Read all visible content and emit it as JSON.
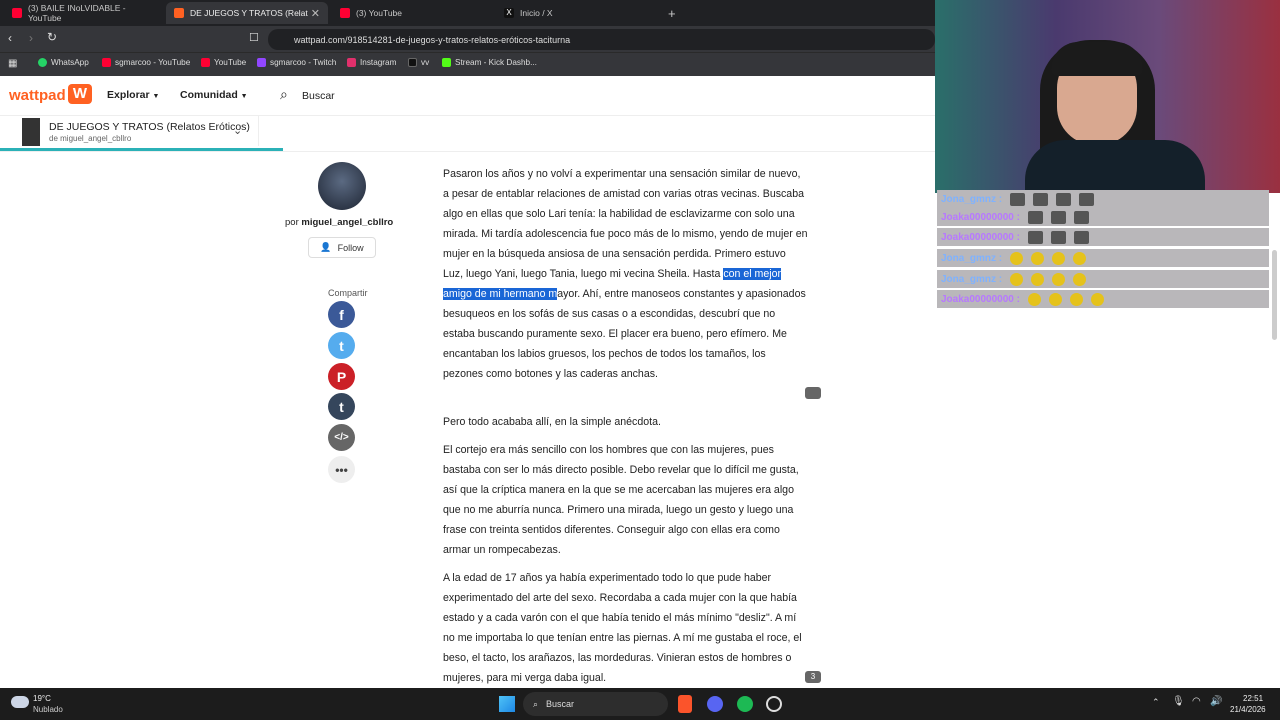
{
  "tabs": [
    {
      "label": "(3) BAILE INoLVIDABLE - YouTube",
      "color": "#ff0033"
    },
    {
      "label": "DE JUEGOS Y TRATOS (Relatos Er...",
      "color": "#ff6122"
    },
    {
      "label": "(3) YouTube",
      "color": "#ff0033"
    },
    {
      "label": "Inicio / X",
      "color": "#444444"
    }
  ],
  "url": "wattpad.com/918514281-de-juegos-y-tratos-relatos-eróticos-taciturna",
  "bookmarks": [
    "WhatsApp",
    "sgmarcoo - YouTube",
    "YouTube",
    "sgmarcoo - Twitch",
    "Instagram",
    "vv",
    "Stream - Kick Dashb..."
  ],
  "header": {
    "logo": "wattpad",
    "explore": "Explorar",
    "community": "Comunidad",
    "search": "Buscar"
  },
  "story": {
    "title": "DE JUEGOS Y TRATOS (Relatos Eróticos)",
    "author_line": "de miguel_angel_cbllro"
  },
  "author": {
    "prefix": "por ",
    "name": "miguel_angel_cbllro",
    "follow": "Follow"
  },
  "share": {
    "label": "Compartir"
  },
  "paragraphs": {
    "p1_before": "Pasaron los años y no volví a experimentar una sensación similar de nuevo, a pesar de entablar relaciones de amistad con varias otras vecinas. Buscaba algo en ellas que solo Lari tenía: la habilidad de esclavizarme con solo una mirada. Mi tardía adolescencia fue poco más de lo mismo, yendo de mujer en mujer en la búsqueda ansiosa de una sensación perdida. Primero estuvo Luz, luego Yani, luego Tania, luego mi vecina Sheila. Hasta ",
    "p1_highlight": "con el mejor amigo de mi hermano m",
    "p1_after": "ayor. Ahí, entre manoseos constantes y apasionados besuqueos en los sofás de sus casas o a escondidas, descubrí que no estaba buscando puramente sexo. El placer era bueno, pero efímero. Me encantaban los labios gruesos, los pechos de todos los tamaños, los pezones como botones y las caderas anchas.",
    "p2": "Pero todo acababa allí, en la simple anécdota.",
    "p3": "El cortejo era más sencillo con los hombres que con las mujeres, pues bastaba con ser lo más directo posible. Debo revelar que lo difícil me gusta, así que la críptica manera en la que se me acercaban las mujeres era algo que no me aburría nunca. Primero una mirada, luego un gesto y luego una frase con treinta sentidos diferentes. Conseguir algo con ellas era como armar un rompecabezas.",
    "p4": "A la edad de 17 años ya había experimentado todo lo que pude haber experimentado del arte del sexo. Recordaba a cada mujer con la que había estado y a cada varón con el que había tenido el más mínimo \"desliz\". A mí no me importaba lo que tenían entre las piernas. A mí me gustaba el roce, el beso, el tacto, los arañazos, las mordeduras. Vinieran estos de hombres o mujeres, para mi verga daba igual."
  },
  "comment_count": "3",
  "chat": [
    {
      "user": "Jona_gmnz :",
      "kind": "u1"
    },
    {
      "user": "Joaka00000000 :",
      "kind": "u2"
    },
    {
      "user": "Joaka00000000 :",
      "kind": "u2"
    },
    {
      "user": "Jona_gmnz :",
      "kind": "u1"
    },
    {
      "user": "Jona_gmnz :",
      "kind": "u1"
    },
    {
      "user": "Joaka00000000 :",
      "kind": "u2"
    }
  ],
  "taskbar": {
    "temp": "19°C",
    "weather": "Nublado",
    "search": "Buscar",
    "time": "22:51",
    "date": "21/4/2026"
  }
}
